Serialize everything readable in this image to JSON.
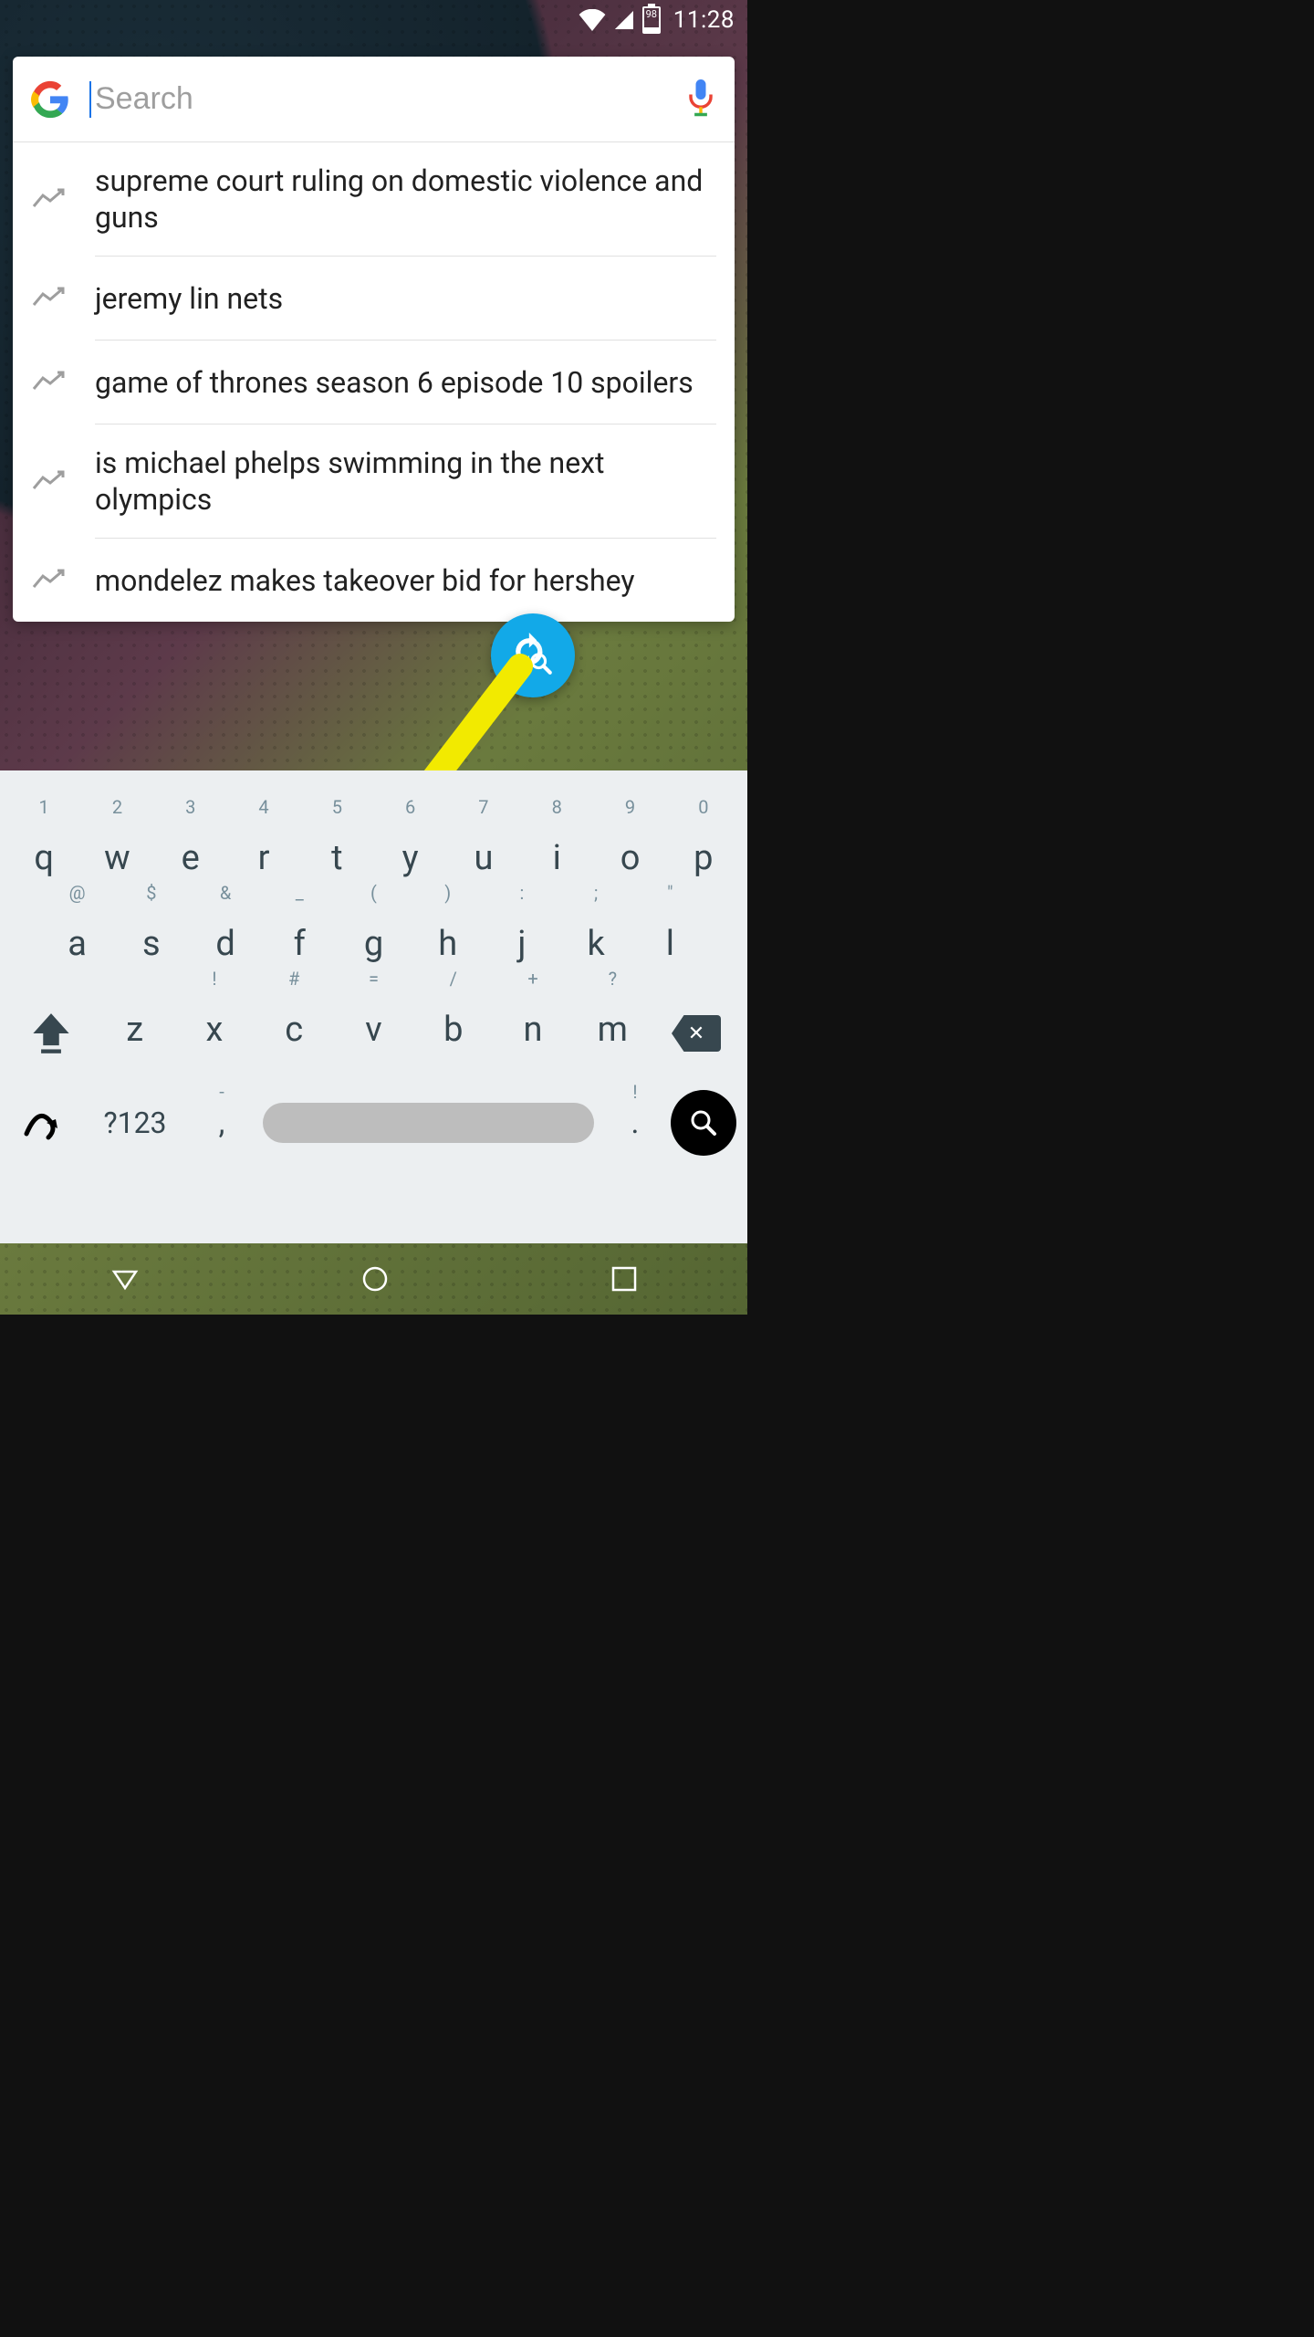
{
  "status": {
    "battery_level": "98",
    "time": "11:28"
  },
  "search": {
    "placeholder": "Search",
    "value": ""
  },
  "suggestions": [
    {
      "text": "supreme court ruling on domestic violence and guns"
    },
    {
      "text": "jeremy lin nets"
    },
    {
      "text": "game of thrones season 6 episode 10 spoilers"
    },
    {
      "text": "is michael phelps swimming in the next olympics"
    },
    {
      "text": "mondelez makes takeover bid for hershey"
    }
  ],
  "keyboard": {
    "row1": [
      {
        "main": "q",
        "hint": "1"
      },
      {
        "main": "w",
        "hint": "2"
      },
      {
        "main": "e",
        "hint": "3"
      },
      {
        "main": "r",
        "hint": "4"
      },
      {
        "main": "t",
        "hint": "5"
      },
      {
        "main": "y",
        "hint": "6"
      },
      {
        "main": "u",
        "hint": "7"
      },
      {
        "main": "i",
        "hint": "8"
      },
      {
        "main": "o",
        "hint": "9"
      },
      {
        "main": "p",
        "hint": "0"
      }
    ],
    "row2": [
      {
        "main": "a",
        "hint": "@"
      },
      {
        "main": "s",
        "hint": "$"
      },
      {
        "main": "d",
        "hint": "&"
      },
      {
        "main": "f",
        "hint": "_"
      },
      {
        "main": "g",
        "hint": "("
      },
      {
        "main": "h",
        "hint": ")"
      },
      {
        "main": "j",
        "hint": ":"
      },
      {
        "main": "k",
        "hint": ";"
      },
      {
        "main": "l",
        "hint": "\""
      }
    ],
    "row3": [
      {
        "main": "z",
        "hint": ""
      },
      {
        "main": "x",
        "hint": "!"
      },
      {
        "main": "c",
        "hint": "#"
      },
      {
        "main": "v",
        "hint": "="
      },
      {
        "main": "b",
        "hint": "/"
      },
      {
        "main": "n",
        "hint": "+"
      },
      {
        "main": "m",
        "hint": "?"
      }
    ],
    "symbols_label": "?123",
    "comma": {
      "main": ",",
      "hint": "-"
    },
    "period": {
      "main": ".",
      "hint": "!"
    }
  }
}
